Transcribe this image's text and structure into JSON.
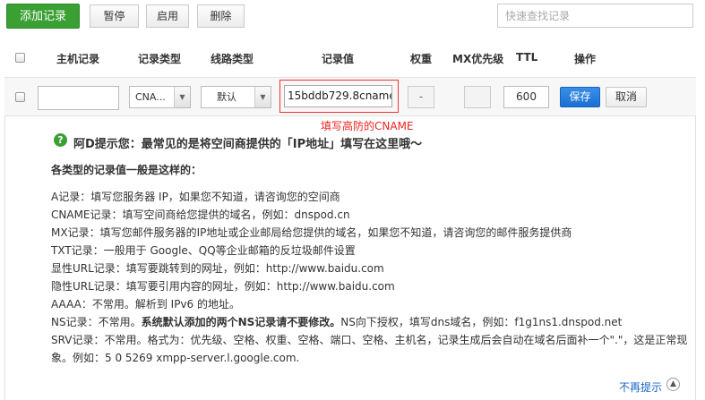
{
  "toolbar": {
    "add_label": "添加记录",
    "pause_label": "暂停",
    "enable_label": "启用",
    "delete_label": "删除",
    "search_placeholder": "快速查找记录"
  },
  "table": {
    "headers": [
      "主机记录",
      "记录类型",
      "线路类型",
      "记录值",
      "权重",
      "MX优先级",
      "TTL",
      "操作"
    ]
  },
  "edit_row": {
    "host_value": "",
    "record_type": "CNA...",
    "line_type": "默认",
    "record_value": "15bddb729.8cname",
    "weight": "-",
    "mx": "",
    "ttl": "600",
    "save_label": "保存",
    "cancel_label": "取消"
  },
  "annotation": "填写高防的CNAME",
  "tip": {
    "title": "阿D提示您：最常见的是将空间商提供的「IP地址」填写在这里哦～",
    "subtitle": "各类型的记录值一般是这样的：",
    "lines": [
      "A记录：填写您服务器 IP，如果您不知道，请咨询您的空间商",
      "CNAME记录：填写空间商给您提供的域名，例如：dnspod.cn",
      "MX记录：填写您邮件服务器的IP地址或企业邮局给您提供的域名，如果您不知道，请咨询您的邮件服务提供商",
      "TXT记录：一般用于 Google、QQ等企业邮箱的反垃圾邮件设置",
      "显性URL记录：填写要跳转到的网址，例如：http://www.baidu.com",
      "隐性URL记录：填写要引用内容的网址，例如：http://www.baidu.com",
      "AAAA：不常用。解析到 IPv6 的地址。"
    ],
    "ns_prefix": "NS记录：不常用。",
    "ns_bold": "系统默认添加的两个NS记录请不要修改。",
    "ns_suffix": "NS向下授权，填写dns域名，例如：f1g1ns1.dnspod.net",
    "srv_line1": "SRV记录：不常用。格式为：优先级、空格、权重、空格、端口、空格、主机名，记录生成后会自动在域名后面补一个\".\"，这是正常现",
    "srv_line2": "象。例如：5 0 5269 xmpp-server.l.google.com.",
    "dismiss_label": "不再提示"
  }
}
